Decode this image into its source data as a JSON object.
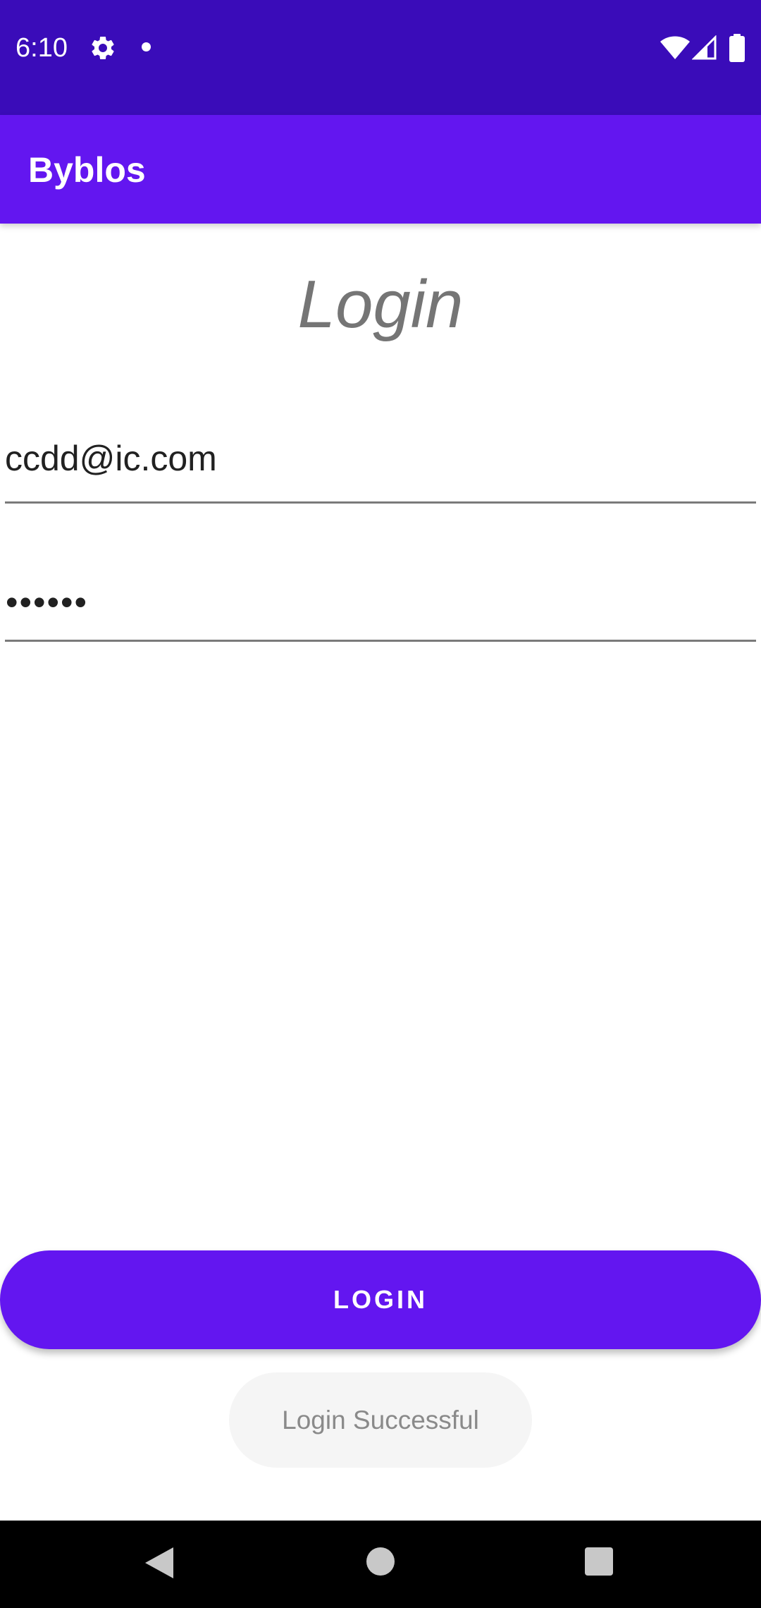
{
  "status_bar": {
    "time": "6:10",
    "icons": [
      "gear-icon",
      "notification-dot-icon",
      "wifi-icon",
      "signal-icon",
      "battery-icon"
    ]
  },
  "app_bar": {
    "title": "Byblos"
  },
  "main": {
    "heading": "Login",
    "email_value": "ccdd@ic.com",
    "password_value": "••••••",
    "login_button_label": "LOGIN"
  },
  "toast": {
    "message": "Login Successful"
  },
  "nav_bar": {
    "icons": [
      "back-icon",
      "home-icon",
      "recents-icon"
    ]
  },
  "colors": {
    "status_bar": "#3a0cb9",
    "primary": "#6316f0",
    "heading_text": "#757575"
  }
}
